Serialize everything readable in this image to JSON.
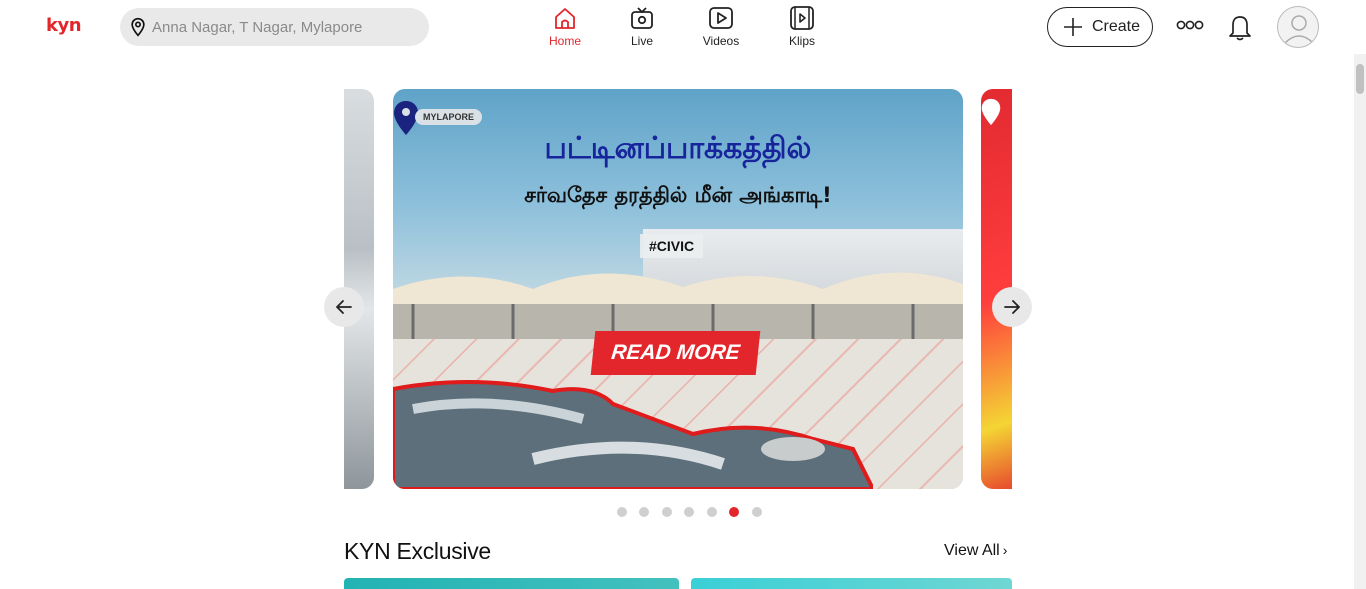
{
  "header": {
    "logo_text": "kyn",
    "search": {
      "placeholder": "Anna Nagar, T Nagar, Mylapore",
      "value": ""
    },
    "nav": [
      {
        "label": "Home",
        "icon": "home-icon",
        "active": true
      },
      {
        "label": "Live",
        "icon": "live-tv-icon",
        "active": false
      },
      {
        "label": "Videos",
        "icon": "video-play-icon",
        "active": false
      },
      {
        "label": "Klips",
        "icon": "klips-icon",
        "active": false
      }
    ],
    "create_label": "Create",
    "accent_color": "#e3262b"
  },
  "carousel": {
    "main_slide": {
      "location_tag": "MYLAPORE",
      "headline_line1": "பட்டினப்பாக்கத்தில்",
      "headline_line2": "சர்வதேச தரத்தில் மீன் அங்காடி!",
      "hashtag": "#CIVIC",
      "cta_label": "READ MORE"
    },
    "dot_count": 7,
    "active_dot": 6
  },
  "section": {
    "title": "KYN Exclusive",
    "view_all_label": "View All",
    "view_all_chevron": "›"
  }
}
